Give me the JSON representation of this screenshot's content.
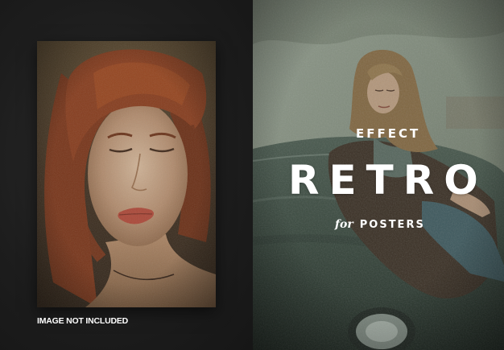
{
  "left": {
    "image_note": "IMAGE NOT INCLUDED",
    "portrait_alt": "portrait photo"
  },
  "right": {
    "effect_label": "EFFECT",
    "title": "RETRO",
    "subtitle_for": "for",
    "subtitle_posters": "POSTERS"
  },
  "colors": {
    "background": "#1d1d1d",
    "text": "#ffffff",
    "hair": "#8a3a1c",
    "photo_tone": "#5b6357"
  }
}
